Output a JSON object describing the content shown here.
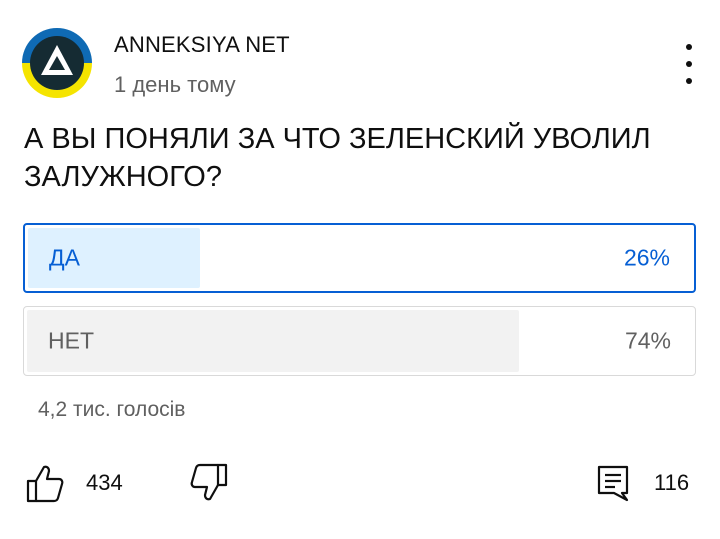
{
  "post": {
    "channel_name": "ANNEKSIYA NET",
    "timestamp": "1 день тому",
    "text": "А ВЫ ПОНЯЛИ ЗА ЧТО ЗЕЛЕНСКИЙ УВОЛИЛ ЗАЛУЖНОГО?",
    "menu_icon": "more-vert-icon",
    "avatar_icon": "triangle-logo-icon"
  },
  "poll": {
    "options": [
      {
        "label": "ДА",
        "percent": "26%",
        "share": 0.26,
        "selected": true
      },
      {
        "label": "НЕТ",
        "percent": "74%",
        "share": 0.74,
        "selected": false
      }
    ],
    "vote_count": "4,2 тис. голосів"
  },
  "actions": {
    "like_count": "434",
    "comment_count": "116",
    "like_icon": "thumb-up-icon",
    "dislike_icon": "thumb-down-icon",
    "comment_icon": "comment-icon"
  },
  "colors": {
    "accent": "#065fd4",
    "selected_fill": "#def1ff",
    "unselected_fill": "#f2f2f2",
    "secondary_text": "#606060",
    "avatar_blue": "#0f6ab4",
    "avatar_yellow": "#f5e400",
    "avatar_dark": "#152b33"
  }
}
